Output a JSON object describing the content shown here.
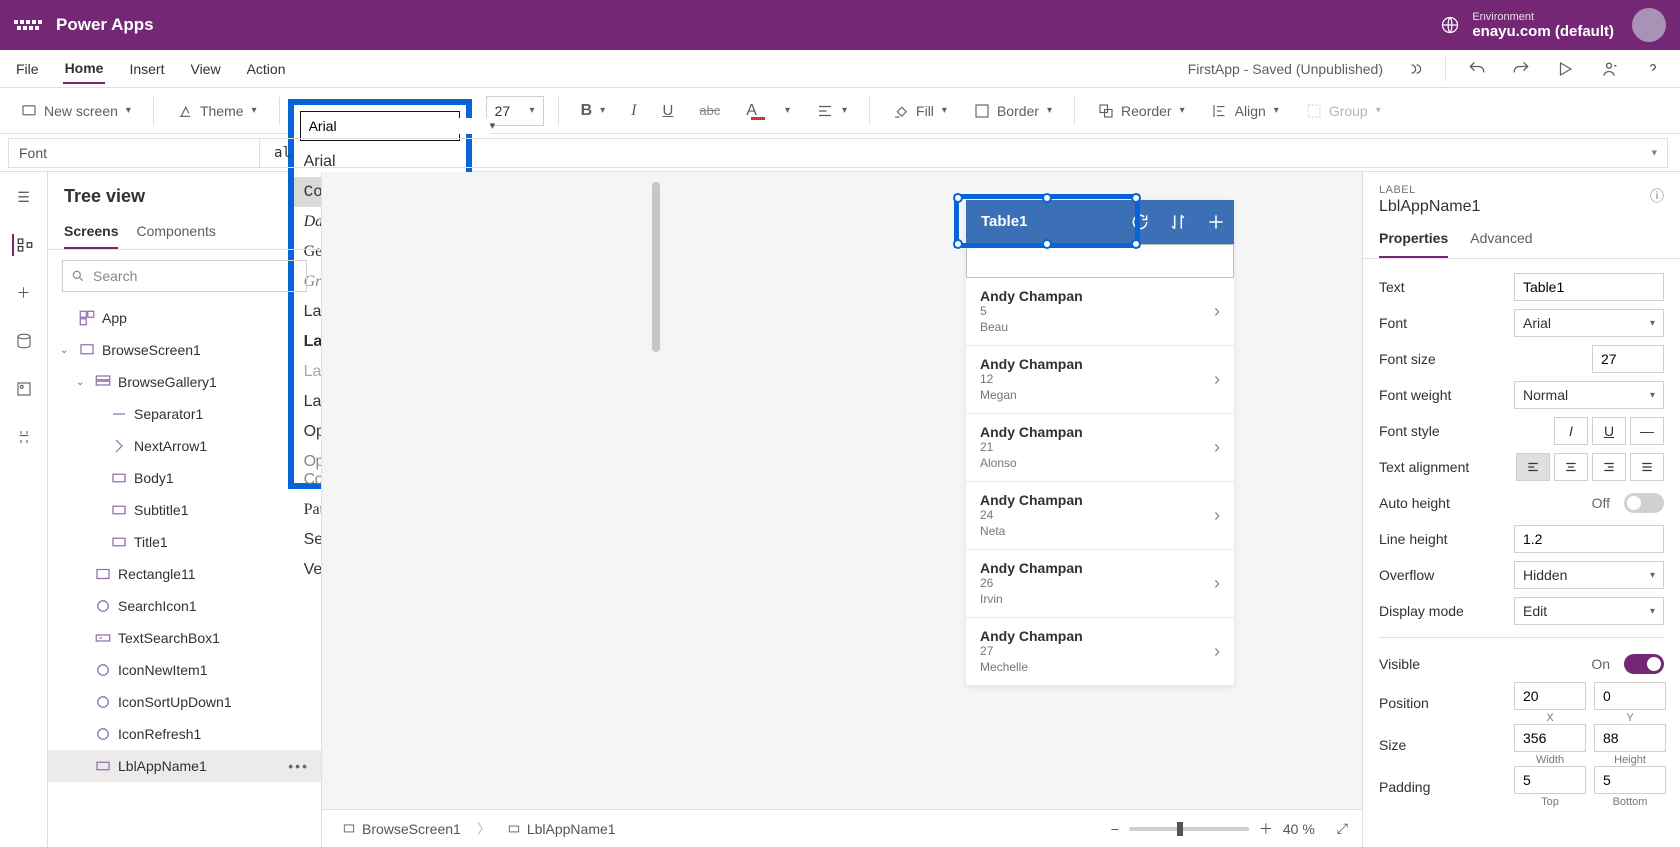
{
  "app_brand": "Power Apps",
  "env": {
    "label": "Environment",
    "value": "enayu.com (default)"
  },
  "menus": [
    "File",
    "Home",
    "Insert",
    "View",
    "Action"
  ],
  "active_menu": "Home",
  "saved_text": "FirstApp - Saved (Unpublished)",
  "ribbon": {
    "new_screen": "New screen",
    "theme": "Theme",
    "font_value": "Arial",
    "size_value": "27",
    "fill": "Fill",
    "border": "Border",
    "reorder": "Reorder",
    "align": "Align",
    "group": "Group"
  },
  "font_options": [
    {
      "label": "Arial",
      "cls": "",
      "hover": false
    },
    {
      "label": "Courier New",
      "cls": "f-courier",
      "hover": true
    },
    {
      "label": "Dancing Script",
      "cls": "f-script",
      "hover": false
    },
    {
      "label": "Georgia",
      "cls": "f-georgia",
      "hover": false
    },
    {
      "label": "Great Vibes",
      "cls": "f-great",
      "hover": false
    },
    {
      "label": "Lato",
      "cls": "",
      "hover": false
    },
    {
      "label": "Lato Black",
      "cls": "f-latoblack",
      "hover": false
    },
    {
      "label": "Lato Hairline",
      "cls": "f-latohair",
      "hover": false
    },
    {
      "label": "Lato Light",
      "cls": "",
      "hover": false
    },
    {
      "label": "Open Sans",
      "cls": "",
      "hover": false
    },
    {
      "label": "Open Sans Condensed",
      "cls": "f-opensanscond",
      "hover": false
    },
    {
      "label": "Patrick Hand",
      "cls": "f-patrick",
      "hover": false
    },
    {
      "label": "Segoe UI",
      "cls": "",
      "hover": false
    },
    {
      "label": "Verdana",
      "cls": "",
      "hover": false
    }
  ],
  "formula": {
    "prop": "Font",
    "value": "al"
  },
  "tree": {
    "title": "Tree view",
    "tabs": [
      "Screens",
      "Components"
    ],
    "active_tab": "Screens",
    "search_placeholder": "Search",
    "items": [
      {
        "name": "App",
        "icon": "app",
        "indent": 0
      },
      {
        "name": "BrowseScreen1",
        "icon": "screen",
        "indent": 0,
        "exp": true
      },
      {
        "name": "BrowseGallery1",
        "icon": "gallery",
        "indent": 1,
        "exp": true
      },
      {
        "name": "Separator1",
        "icon": "sep",
        "indent": 2
      },
      {
        "name": "NextArrow1",
        "icon": "arrow",
        "indent": 2
      },
      {
        "name": "Body1",
        "icon": "label",
        "indent": 2
      },
      {
        "name": "Subtitle1",
        "icon": "label",
        "indent": 2
      },
      {
        "name": "Title1",
        "icon": "label",
        "indent": 2
      },
      {
        "name": "Rectangle11",
        "icon": "rect",
        "indent": 1
      },
      {
        "name": "SearchIcon1",
        "icon": "icon",
        "indent": 1
      },
      {
        "name": "TextSearchBox1",
        "icon": "textbox",
        "indent": 1
      },
      {
        "name": "IconNewItem1",
        "icon": "icon",
        "indent": 1
      },
      {
        "name": "IconSortUpDown1",
        "icon": "icon",
        "indent": 1
      },
      {
        "name": "IconRefresh1",
        "icon": "icon",
        "indent": 1
      },
      {
        "name": "LblAppName1",
        "icon": "label",
        "indent": 1,
        "sel": true
      }
    ]
  },
  "canvas": {
    "title_label": "Table1",
    "rows": [
      {
        "name": "Andy Champan",
        "n": "5",
        "sub": "Beau"
      },
      {
        "name": "Andy Champan",
        "n": "12",
        "sub": "Megan"
      },
      {
        "name": "Andy Champan",
        "n": "21",
        "sub": "Alonso"
      },
      {
        "name": "Andy Champan",
        "n": "24",
        "sub": "Neta"
      },
      {
        "name": "Andy Champan",
        "n": "26",
        "sub": "Irvin"
      },
      {
        "name": "Andy Champan",
        "n": "27",
        "sub": "Mechelle"
      }
    ]
  },
  "breadcrumb": {
    "a": "BrowseScreen1",
    "b": "LblAppName1"
  },
  "zoom": "40  %",
  "panel": {
    "kind": "LABEL",
    "name": "LblAppName1",
    "tabs": [
      "Properties",
      "Advanced"
    ],
    "active_tab": "Properties",
    "text_label": "Text",
    "text_value": "Table1",
    "font_label": "Font",
    "font_value": "Arial",
    "fontsize_label": "Font size",
    "fontsize_value": "27",
    "fontweight_label": "Font weight",
    "fontweight_value": "Normal",
    "fontstyle_label": "Font style",
    "textalign_label": "Text alignment",
    "autoheight_label": "Auto height",
    "autoheight_state": "Off",
    "lineheight_label": "Line height",
    "lineheight_value": "1.2",
    "overflow_label": "Overflow",
    "overflow_value": "Hidden",
    "displaymode_label": "Display mode",
    "displaymode_value": "Edit",
    "visible_label": "Visible",
    "visible_state": "On",
    "position_label": "Position",
    "pos_x": "20",
    "pos_y": "0",
    "pos_xl": "X",
    "pos_yl": "Y",
    "size_label": "Size",
    "size_w": "356",
    "size_h": "88",
    "size_wl": "Width",
    "size_hl": "Height",
    "padding_label": "Padding",
    "pad_t": "5",
    "pad_b": "5",
    "pad_tl": "Top",
    "pad_bl": "Bottom"
  }
}
